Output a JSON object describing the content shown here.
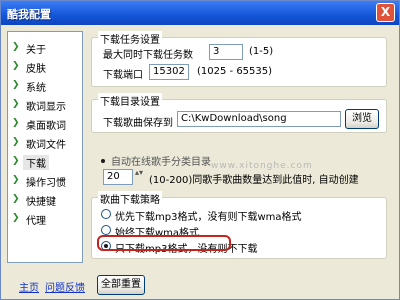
{
  "window": {
    "title": "酷我配置",
    "close_glyph": "X"
  },
  "sidebar": {
    "items": [
      {
        "label": "关于"
      },
      {
        "label": "皮肤"
      },
      {
        "label": "系统"
      },
      {
        "label": "歌词显示"
      },
      {
        "label": "桌面歌词"
      },
      {
        "label": "歌词文件"
      },
      {
        "label": "下载",
        "selected": true
      },
      {
        "label": "操作习惯"
      },
      {
        "label": "快捷键"
      },
      {
        "label": "代理"
      }
    ]
  },
  "footer": {
    "home_link": "主页",
    "feedback_link": "问题反馈",
    "reset_button": "全部重置"
  },
  "download_task": {
    "title": "下载任务设置",
    "max_label": "最大同时下载任务数",
    "max_value": "3",
    "max_range": "(1-5)",
    "port_label": "下载端口",
    "port_value": "15302",
    "port_range": "(1025 - 65535)"
  },
  "download_dir": {
    "title": "下载目录设置",
    "save_label": "下载歌曲保存到",
    "save_value": "C:\\KwDownload\\song",
    "browse_button": "浏览"
  },
  "auto_folder": {
    "checkbox_label": "自动在线歌手分类目录",
    "count_value": "20",
    "count_desc": "(10-200)同歌手歌曲数量达到此值时, 自动创建"
  },
  "strategy": {
    "title": "歌曲下载策略",
    "options": [
      {
        "label": "优先下载mp3格式，没有则下载wma格式",
        "checked": false
      },
      {
        "label": "始终下载wma格式",
        "checked": false
      },
      {
        "label": "只下载mp3格式，没有则不下载",
        "checked": true
      }
    ]
  },
  "watermark": "www.xitonghe.com"
}
